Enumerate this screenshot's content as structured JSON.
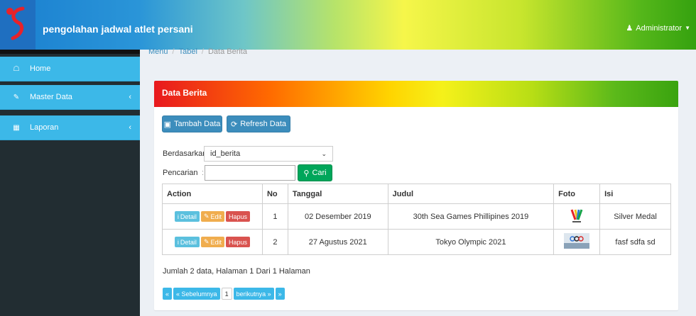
{
  "header": {
    "title": "pengolahan jadwal atlet persani",
    "user_label": "Administrator",
    "user_icon": "user-icon"
  },
  "sidebar": {
    "items": [
      {
        "label": "Home",
        "icon": "home-icon"
      },
      {
        "label": "Master Data",
        "icon": "edit-icon"
      },
      {
        "label": "Laporan",
        "icon": "calendar-icon"
      }
    ],
    "arrow": "‹"
  },
  "breadcrumb": [
    "Menu",
    "Tabel",
    "Data Berita"
  ],
  "box": {
    "title": "Data Berita"
  },
  "toolbar": {
    "add_label": "Tambah Data",
    "refresh_label": "Refresh Data"
  },
  "filter": {
    "by_label": "Berdasarkan:",
    "by_value": "id_berita",
    "search_label": "Pencarian",
    "search_colon": ":",
    "search_value": "",
    "search_button": "Cari"
  },
  "table": {
    "headers": [
      "Action",
      "No",
      "Tanggal",
      "Judul",
      "Foto",
      "Isi"
    ],
    "action_labels": {
      "detail": "Detail",
      "edit": "Edit",
      "delete": "Hapus"
    },
    "rows": [
      {
        "no": "1",
        "tanggal": "02 Desember 2019",
        "judul": "30th Sea Games Phillipines 2019",
        "isi": "Silver Medal"
      },
      {
        "no": "2",
        "tanggal": "27 Agustus 2021",
        "judul": "Tokyo Olympic 2021",
        "isi": "fasf sdfa sd"
      }
    ]
  },
  "summary": "Jumlah 2 data, Halaman 1 Dari 1 Halaman",
  "pagination": {
    "first": "«",
    "prev": "« Sebelumnya",
    "current": "1",
    "next": "berikutnya »",
    "last": "»"
  },
  "colors": {
    "primary": "#3c8dbc",
    "success": "#00a65a",
    "sidebar_item": "#3cb8e8",
    "sidebar_bg": "#222d32"
  }
}
